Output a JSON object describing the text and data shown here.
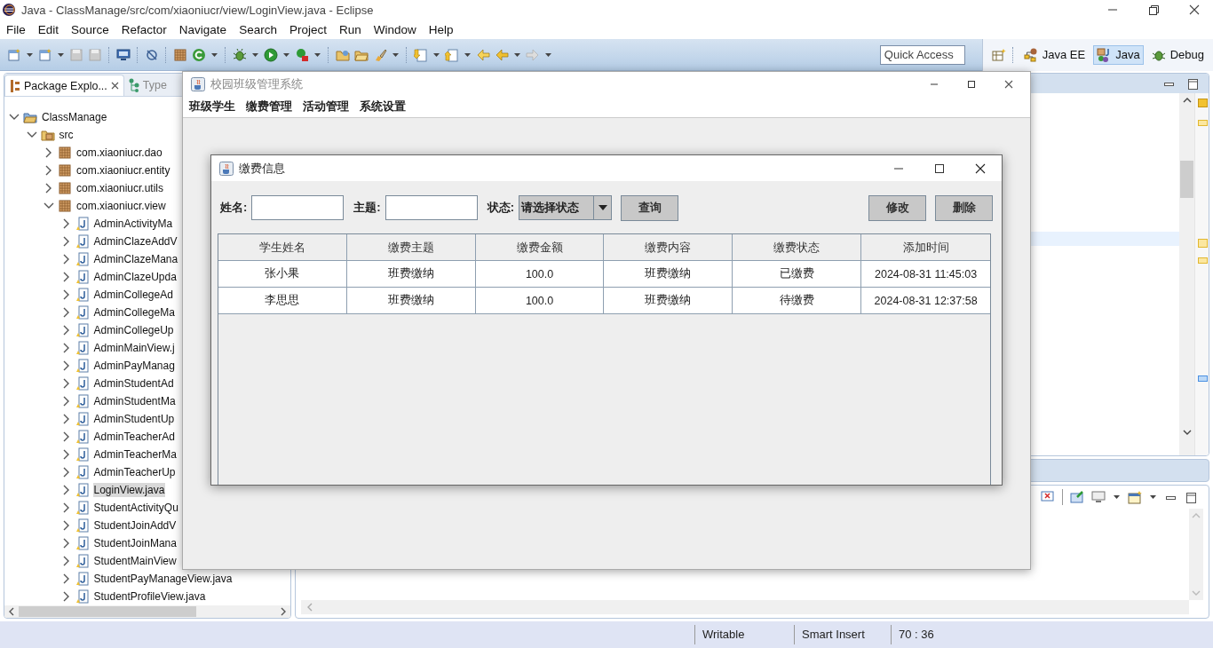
{
  "eclipse": {
    "title": "Java - ClassManage/src/com/xiaoniucr/view/LoginView.java - Eclipse",
    "menu": [
      "File",
      "Edit",
      "Source",
      "Refactor",
      "Navigate",
      "Search",
      "Project",
      "Run",
      "Window",
      "Help"
    ],
    "quick_access": {
      "placeholder": "Quick Access"
    },
    "perspectives": [
      {
        "label": "Java EE",
        "selected": false
      },
      {
        "label": "Java",
        "selected": true
      },
      {
        "label": "Debug",
        "selected": false
      }
    ]
  },
  "package_explorer": {
    "tabs": [
      {
        "label": "Package Explo...",
        "selected": true
      },
      {
        "label": "Type",
        "selected": false
      }
    ],
    "tree": [
      {
        "label": "ClassManage",
        "kind": "project",
        "expanded": true,
        "selected": false,
        "children": [
          {
            "label": "src",
            "kind": "folder",
            "expanded": true,
            "selected": false,
            "children": [
              {
                "label": "com.xiaoniucr.dao",
                "kind": "package",
                "expanded": false,
                "selected": false
              },
              {
                "label": "com.xiaoniucr.entity",
                "kind": "package",
                "expanded": false,
                "selected": false
              },
              {
                "label": "com.xiaoniucr.utils",
                "kind": "package",
                "expanded": false,
                "selected": false
              },
              {
                "label": "com.xiaoniucr.view",
                "kind": "package",
                "expanded": true,
                "selected": false,
                "children": [
                  {
                    "label": "AdminActivityMa",
                    "kind": "file",
                    "expanded": false,
                    "selected": false
                  },
                  {
                    "label": "AdminClazeAddV",
                    "kind": "file",
                    "expanded": false,
                    "selected": false
                  },
                  {
                    "label": "AdminClazeMana",
                    "kind": "file",
                    "expanded": false,
                    "selected": false
                  },
                  {
                    "label": "AdminClazeUpda",
                    "kind": "file",
                    "expanded": false,
                    "selected": false
                  },
                  {
                    "label": "AdminCollegeAd",
                    "kind": "file",
                    "expanded": false,
                    "selected": false
                  },
                  {
                    "label": "AdminCollegeMa",
                    "kind": "file",
                    "expanded": false,
                    "selected": false
                  },
                  {
                    "label": "AdminCollegeUp",
                    "kind": "file",
                    "expanded": false,
                    "selected": false
                  },
                  {
                    "label": "AdminMainView.j",
                    "kind": "file",
                    "expanded": false,
                    "selected": false
                  },
                  {
                    "label": "AdminPayManag",
                    "kind": "file",
                    "expanded": false,
                    "selected": false
                  },
                  {
                    "label": "AdminStudentAd",
                    "kind": "file",
                    "expanded": false,
                    "selected": false
                  },
                  {
                    "label": "AdminStudentMa",
                    "kind": "file",
                    "expanded": false,
                    "selected": false
                  },
                  {
                    "label": "AdminStudentUp",
                    "kind": "file",
                    "expanded": false,
                    "selected": false
                  },
                  {
                    "label": "AdminTeacherAd",
                    "kind": "file",
                    "expanded": false,
                    "selected": false
                  },
                  {
                    "label": "AdminTeacherMa",
                    "kind": "file",
                    "expanded": false,
                    "selected": false
                  },
                  {
                    "label": "AdminTeacherUp",
                    "kind": "file",
                    "expanded": false,
                    "selected": false
                  },
                  {
                    "label": "LoginView.java",
                    "kind": "file",
                    "expanded": false,
                    "selected": true
                  },
                  {
                    "label": "StudentActivityQu",
                    "kind": "file",
                    "expanded": false,
                    "selected": false
                  },
                  {
                    "label": "StudentJoinAddV",
                    "kind": "file",
                    "expanded": false,
                    "selected": false
                  },
                  {
                    "label": "StudentJoinMana",
                    "kind": "file",
                    "expanded": false,
                    "selected": false
                  },
                  {
                    "label": "StudentMainView",
                    "kind": "file",
                    "expanded": false,
                    "selected": false
                  },
                  {
                    "label": "StudentPayManageView.java",
                    "kind": "file",
                    "expanded": false,
                    "selected": false
                  },
                  {
                    "label": "StudentProfileView.java",
                    "kind": "file",
                    "expanded": false,
                    "selected": false
                  }
                ]
              }
            ]
          }
        ]
      }
    ]
  },
  "app_window": {
    "title": "校园班级管理系统",
    "menu": [
      "班级学生",
      "缴费管理",
      "活动管理",
      "系统设置"
    ]
  },
  "dialog": {
    "title": "缴费信息",
    "filters": [
      {
        "kind": "text",
        "label": "姓名:"
      },
      {
        "kind": "text",
        "label": "主题:"
      },
      {
        "kind": "select",
        "label": "状态:",
        "value": "请选择状态"
      }
    ],
    "search_button": "查询",
    "actions": [
      "修改",
      "删除"
    ],
    "table": {
      "columns": [
        "学生姓名",
        "缴费主题",
        "缴费金额",
        "缴费内容",
        "缴费状态",
        "添加时间"
      ],
      "rows": [
        [
          "张小果",
          "班费缴纳",
          "100.0",
          "班费缴纳",
          "已缴费",
          "2024-08-31 11:45:03"
        ],
        [
          "李思思",
          "班费缴纳",
          "100.0",
          "班费缴纳",
          "待缴费",
          "2024-08-31 12:37:58"
        ]
      ]
    }
  },
  "status_bar": [
    "Writable",
    "Smart Insert",
    "70 : 36"
  ]
}
